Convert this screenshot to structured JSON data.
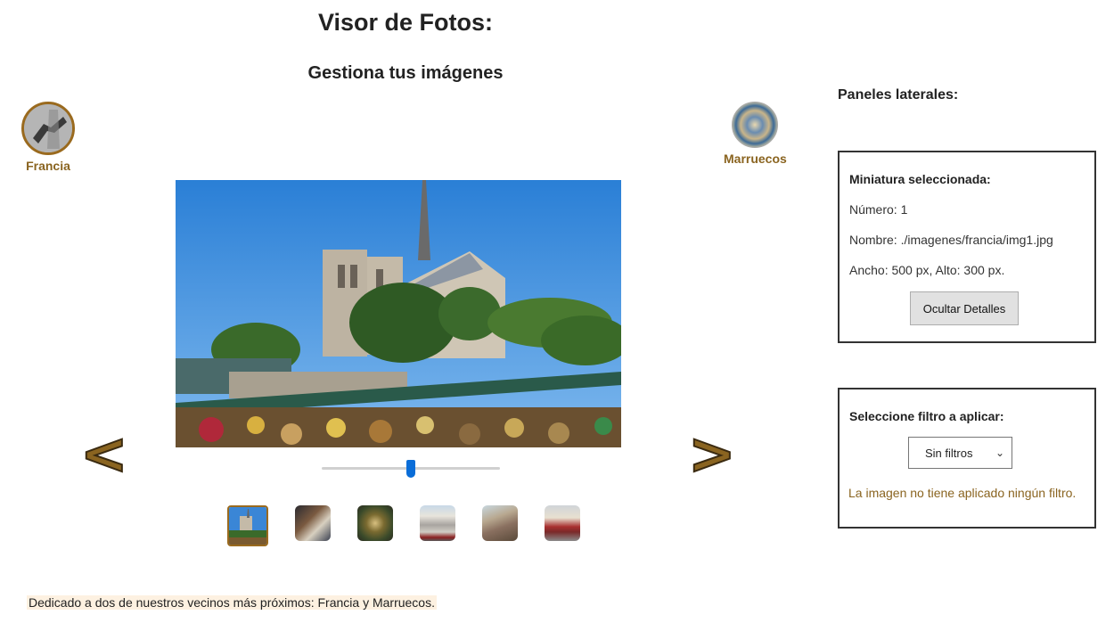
{
  "header": {
    "title": "Visor de Fotos:",
    "subtitle": "Gestiona tus imágenes"
  },
  "countries": {
    "left": {
      "label": "Francia"
    },
    "right": {
      "label": "Marruecos"
    }
  },
  "viewer": {
    "prev_label": "<",
    "next_label": ">",
    "zoom_level": 0.5,
    "selected_thumbnail": 1,
    "thumbnails": [
      {
        "index": 1,
        "selected": true
      },
      {
        "index": 2,
        "selected": false
      },
      {
        "index": 3,
        "selected": false
      },
      {
        "index": 4,
        "selected": false
      },
      {
        "index": 5,
        "selected": false
      },
      {
        "index": 6,
        "selected": false
      }
    ]
  },
  "sidepanels": {
    "title": "Paneles laterales:",
    "details": {
      "heading": "Miniatura seleccionada:",
      "number": "Número: 1",
      "name": "Nombre: ./imagenes/francia/img1.jpg",
      "size": "Ancho: 500 px, Alto: 300 px.",
      "button_label": "Ocultar Detalles"
    },
    "filter": {
      "heading": "Seleccione filtro a aplicar:",
      "selected_option": "Sin filtros",
      "status": "La imagen no tiene aplicado ningún filtro."
    }
  },
  "footer": {
    "text": "Dedicado a dos de nuestros vecinos más próximos: Francia y Marruecos."
  },
  "colors": {
    "accent": "#8a6420",
    "panel_border": "#333333",
    "slider": "#0a6dd8",
    "footer_highlight": "#fdf1e1"
  },
  "icons": {
    "select_chevron": "chevron-down-icon"
  }
}
